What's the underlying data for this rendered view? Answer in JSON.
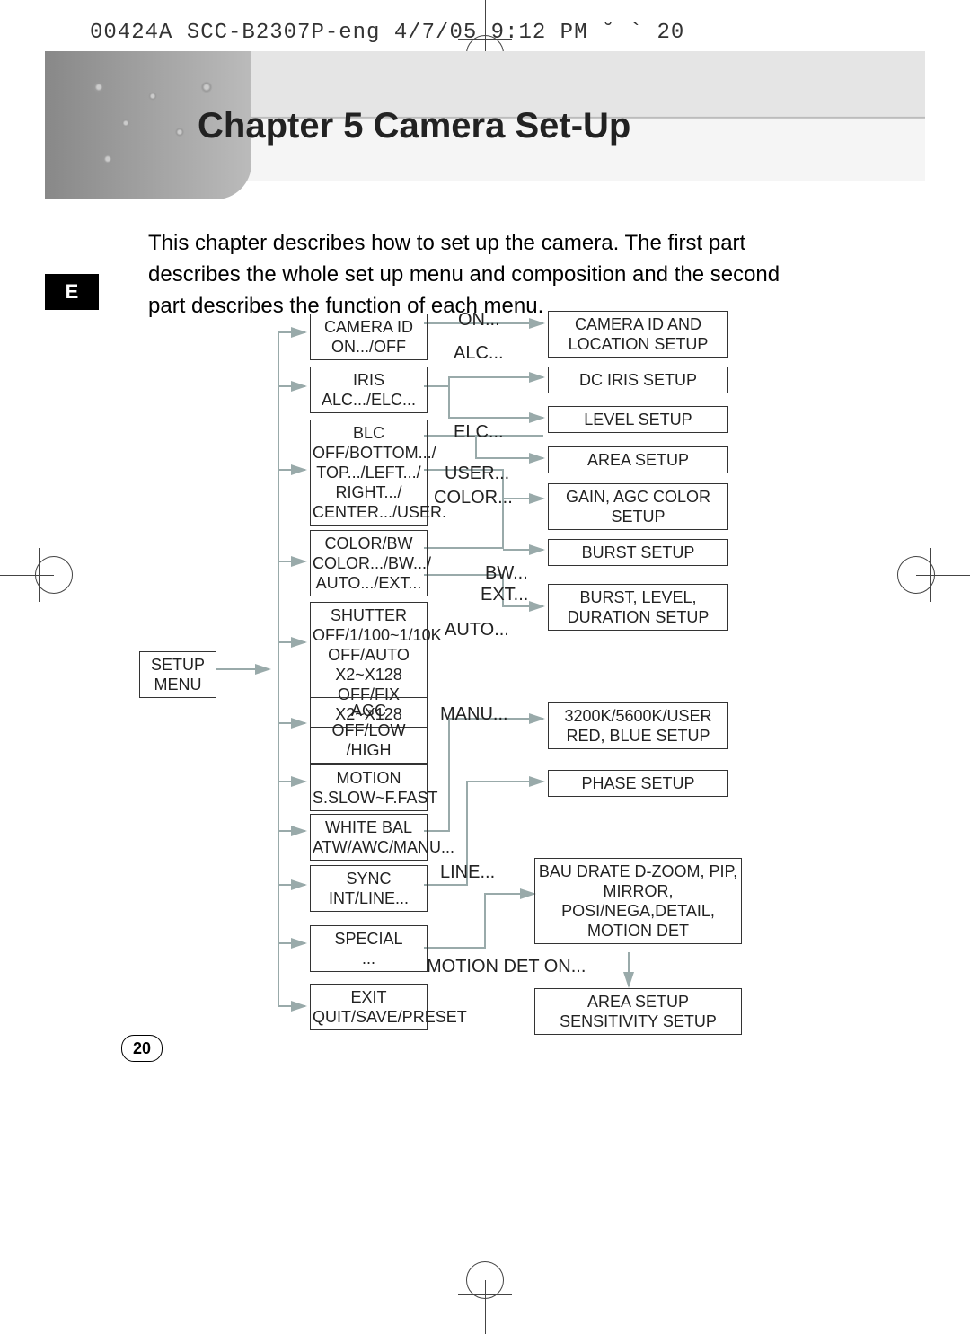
{
  "header": {
    "slug": "00424A SCC-B2307P-eng  4/7/05 9:12 PM  ˘  `  20",
    "chapter_title": "Chapter 5    Camera Set-Up",
    "lang_tab": "E"
  },
  "intro_text": "This chapter describes how to set up the camera. The first part describes the whole set up menu and composition and the second part describes the function of each menu.",
  "page_number": "20",
  "flow": {
    "root": "SETUP\nMENU",
    "col2": {
      "camera_id": "CAMERA ID\nON.../OFF",
      "iris": "IRIS\nALC.../ELC...",
      "blc": "BLC\nOFF/BOTTOM.../\nTOP.../LEFT.../\nRIGHT.../\nCENTER.../USER.",
      "color_bw": "COLOR/BW\nCOLOR.../BW.../\nAUTO.../EXT...",
      "shutter": "SHUTTER\nOFF/1/100~1/10K\nOFF/AUTO X2~X128\nOFF/FIX X2~X128",
      "agc": "AGC\nOFF/LOW\n/HIGH",
      "motion": "MOTION\nS.SLOW~F.FAST",
      "white_bal": "WHITE BAL\nATW/AWC/MANU...",
      "sync": "SYNC\nINT/LINE...",
      "special": "SPECIAL\n...",
      "exit": "EXIT\nQUIT/SAVE/PRESET"
    },
    "mid_labels": {
      "on": "ON...",
      "alc": "ALC...",
      "elc": "ELC...",
      "user": "USER...",
      "color": "COLOR...",
      "bw": "BW...",
      "ext": "EXT...",
      "auto": "AUTO...",
      "manu": "MANU...",
      "line": "LINE...",
      "motion_det_on": "MOTION DET ON..."
    },
    "col3": {
      "camera_id_loc": "CAMERA ID AND\nLOCATION SETUP",
      "dc_iris": "DC IRIS SETUP",
      "level": "LEVEL SETUP",
      "area": "AREA SETUP",
      "gain_agc": "GAIN, AGC COLOR\nSETUP",
      "burst": "BURST SETUP",
      "burst_lvl": "BURST, LEVEL,\nDURATION SETUP",
      "wb_user": "3200K/5600K/USER\nRED, BLUE SETUP",
      "phase": "PHASE SETUP",
      "special_big": "BAU DRATE D-ZOOM, PIP,\nMIRROR,\nPOSI/NEGA,DETAIL,\nMOTION DET",
      "motion_area": "AREA SETUP\nSENSITIVITY SETUP"
    }
  }
}
